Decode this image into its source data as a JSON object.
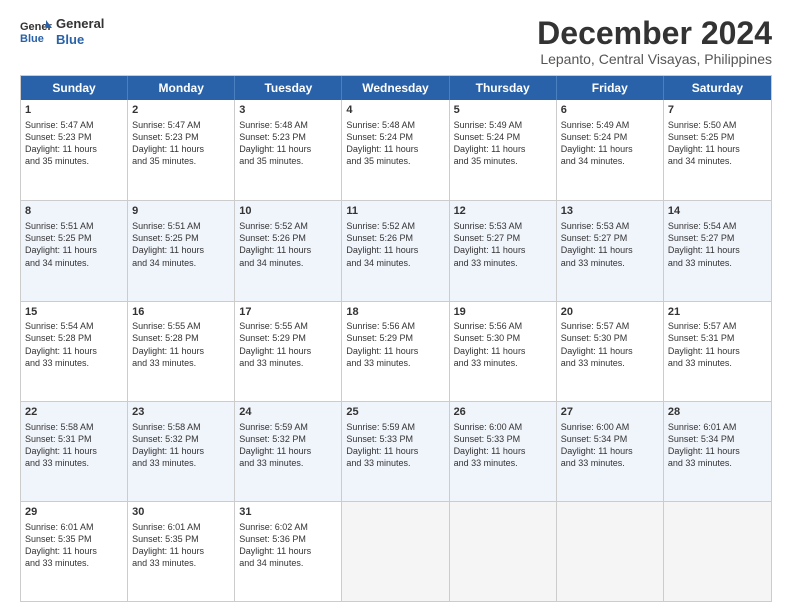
{
  "logo": {
    "line1": "General",
    "line2": "Blue"
  },
  "title": "December 2024",
  "location": "Lepanto, Central Visayas, Philippines",
  "weekdays": [
    "Sunday",
    "Monday",
    "Tuesday",
    "Wednesday",
    "Thursday",
    "Friday",
    "Saturday"
  ],
  "weeks": [
    [
      {
        "day": "1",
        "lines": [
          "Sunrise: 5:47 AM",
          "Sunset: 5:23 PM",
          "Daylight: 11 hours",
          "and 35 minutes."
        ]
      },
      {
        "day": "2",
        "lines": [
          "Sunrise: 5:47 AM",
          "Sunset: 5:23 PM",
          "Daylight: 11 hours",
          "and 35 minutes."
        ]
      },
      {
        "day": "3",
        "lines": [
          "Sunrise: 5:48 AM",
          "Sunset: 5:23 PM",
          "Daylight: 11 hours",
          "and 35 minutes."
        ]
      },
      {
        "day": "4",
        "lines": [
          "Sunrise: 5:48 AM",
          "Sunset: 5:24 PM",
          "Daylight: 11 hours",
          "and 35 minutes."
        ]
      },
      {
        "day": "5",
        "lines": [
          "Sunrise: 5:49 AM",
          "Sunset: 5:24 PM",
          "Daylight: 11 hours",
          "and 35 minutes."
        ]
      },
      {
        "day": "6",
        "lines": [
          "Sunrise: 5:49 AM",
          "Sunset: 5:24 PM",
          "Daylight: 11 hours",
          "and 34 minutes."
        ]
      },
      {
        "day": "7",
        "lines": [
          "Sunrise: 5:50 AM",
          "Sunset: 5:25 PM",
          "Daylight: 11 hours",
          "and 34 minutes."
        ]
      }
    ],
    [
      {
        "day": "8",
        "lines": [
          "Sunrise: 5:51 AM",
          "Sunset: 5:25 PM",
          "Daylight: 11 hours",
          "and 34 minutes."
        ]
      },
      {
        "day": "9",
        "lines": [
          "Sunrise: 5:51 AM",
          "Sunset: 5:25 PM",
          "Daylight: 11 hours",
          "and 34 minutes."
        ]
      },
      {
        "day": "10",
        "lines": [
          "Sunrise: 5:52 AM",
          "Sunset: 5:26 PM",
          "Daylight: 11 hours",
          "and 34 minutes."
        ]
      },
      {
        "day": "11",
        "lines": [
          "Sunrise: 5:52 AM",
          "Sunset: 5:26 PM",
          "Daylight: 11 hours",
          "and 34 minutes."
        ]
      },
      {
        "day": "12",
        "lines": [
          "Sunrise: 5:53 AM",
          "Sunset: 5:27 PM",
          "Daylight: 11 hours",
          "and 33 minutes."
        ]
      },
      {
        "day": "13",
        "lines": [
          "Sunrise: 5:53 AM",
          "Sunset: 5:27 PM",
          "Daylight: 11 hours",
          "and 33 minutes."
        ]
      },
      {
        "day": "14",
        "lines": [
          "Sunrise: 5:54 AM",
          "Sunset: 5:27 PM",
          "Daylight: 11 hours",
          "and 33 minutes."
        ]
      }
    ],
    [
      {
        "day": "15",
        "lines": [
          "Sunrise: 5:54 AM",
          "Sunset: 5:28 PM",
          "Daylight: 11 hours",
          "and 33 minutes."
        ]
      },
      {
        "day": "16",
        "lines": [
          "Sunrise: 5:55 AM",
          "Sunset: 5:28 PM",
          "Daylight: 11 hours",
          "and 33 minutes."
        ]
      },
      {
        "day": "17",
        "lines": [
          "Sunrise: 5:55 AM",
          "Sunset: 5:29 PM",
          "Daylight: 11 hours",
          "and 33 minutes."
        ]
      },
      {
        "day": "18",
        "lines": [
          "Sunrise: 5:56 AM",
          "Sunset: 5:29 PM",
          "Daylight: 11 hours",
          "and 33 minutes."
        ]
      },
      {
        "day": "19",
        "lines": [
          "Sunrise: 5:56 AM",
          "Sunset: 5:30 PM",
          "Daylight: 11 hours",
          "and 33 minutes."
        ]
      },
      {
        "day": "20",
        "lines": [
          "Sunrise: 5:57 AM",
          "Sunset: 5:30 PM",
          "Daylight: 11 hours",
          "and 33 minutes."
        ]
      },
      {
        "day": "21",
        "lines": [
          "Sunrise: 5:57 AM",
          "Sunset: 5:31 PM",
          "Daylight: 11 hours",
          "and 33 minutes."
        ]
      }
    ],
    [
      {
        "day": "22",
        "lines": [
          "Sunrise: 5:58 AM",
          "Sunset: 5:31 PM",
          "Daylight: 11 hours",
          "and 33 minutes."
        ]
      },
      {
        "day": "23",
        "lines": [
          "Sunrise: 5:58 AM",
          "Sunset: 5:32 PM",
          "Daylight: 11 hours",
          "and 33 minutes."
        ]
      },
      {
        "day": "24",
        "lines": [
          "Sunrise: 5:59 AM",
          "Sunset: 5:32 PM",
          "Daylight: 11 hours",
          "and 33 minutes."
        ]
      },
      {
        "day": "25",
        "lines": [
          "Sunrise: 5:59 AM",
          "Sunset: 5:33 PM",
          "Daylight: 11 hours",
          "and 33 minutes."
        ]
      },
      {
        "day": "26",
        "lines": [
          "Sunrise: 6:00 AM",
          "Sunset: 5:33 PM",
          "Daylight: 11 hours",
          "and 33 minutes."
        ]
      },
      {
        "day": "27",
        "lines": [
          "Sunrise: 6:00 AM",
          "Sunset: 5:34 PM",
          "Daylight: 11 hours",
          "and 33 minutes."
        ]
      },
      {
        "day": "28",
        "lines": [
          "Sunrise: 6:01 AM",
          "Sunset: 5:34 PM",
          "Daylight: 11 hours",
          "and 33 minutes."
        ]
      }
    ],
    [
      {
        "day": "29",
        "lines": [
          "Sunrise: 6:01 AM",
          "Sunset: 5:35 PM",
          "Daylight: 11 hours",
          "and 33 minutes."
        ]
      },
      {
        "day": "30",
        "lines": [
          "Sunrise: 6:01 AM",
          "Sunset: 5:35 PM",
          "Daylight: 11 hours",
          "and 33 minutes."
        ]
      },
      {
        "day": "31",
        "lines": [
          "Sunrise: 6:02 AM",
          "Sunset: 5:36 PM",
          "Daylight: 11 hours",
          "and 34 minutes."
        ]
      },
      {
        "day": "",
        "lines": []
      },
      {
        "day": "",
        "lines": []
      },
      {
        "day": "",
        "lines": []
      },
      {
        "day": "",
        "lines": []
      }
    ]
  ]
}
